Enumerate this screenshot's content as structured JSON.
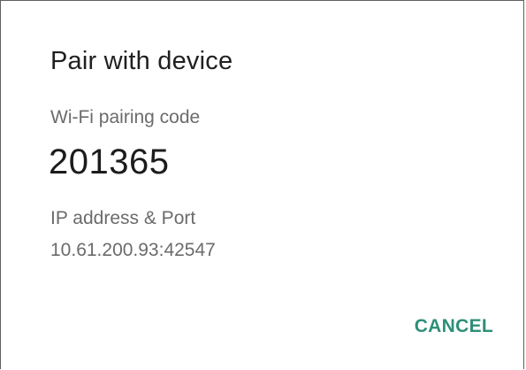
{
  "dialog": {
    "title": "Pair with device",
    "pairing_code_label": "Wi-Fi pairing code",
    "pairing_code": "201365",
    "ip_label": "IP address & Port",
    "ip_value": "10.61.200.93:42547",
    "cancel_label": "CANCEL"
  },
  "colors": {
    "accent": "#2e8f78",
    "title_text": "#202020",
    "secondary_text": "#6b6b6b"
  }
}
